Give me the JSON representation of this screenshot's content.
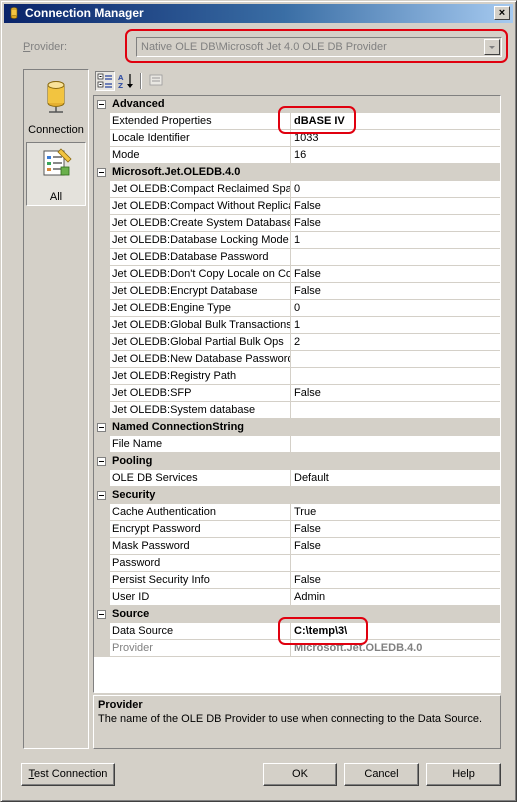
{
  "window": {
    "title": "Connection Manager",
    "close_glyph": "×"
  },
  "provider": {
    "label_prefix": "P",
    "label_rest": "rovider:",
    "value": "Native OLE DB\\Microsoft Jet 4.0 OLE DB Provider"
  },
  "sidebar": {
    "items": [
      {
        "label": "Connection",
        "icon": "database-cylinder-icon"
      },
      {
        "label": "All",
        "icon": "properties-sheet-icon",
        "selected": true
      }
    ]
  },
  "toolbar": {
    "buttons": [
      "categorized-icon",
      "alphabetical-icon",
      "property-pages-icon"
    ]
  },
  "grid": {
    "categories": [
      {
        "name": "Advanced",
        "props": [
          {
            "name": "Extended Properties",
            "value": "dBASE IV",
            "bold": true
          },
          {
            "name": "Locale Identifier",
            "value": "1033"
          },
          {
            "name": "Mode",
            "value": "16"
          }
        ]
      },
      {
        "name": "Microsoft.Jet.OLEDB.4.0",
        "props": [
          {
            "name": "Jet OLEDB:Compact Reclaimed Space",
            "value": "0"
          },
          {
            "name": "Jet OLEDB:Compact Without Replica",
            "value": "False"
          },
          {
            "name": "Jet OLEDB:Create System Database",
            "value": "False"
          },
          {
            "name": "Jet OLEDB:Database Locking Mode",
            "value": "1"
          },
          {
            "name": "Jet OLEDB:Database Password",
            "value": ""
          },
          {
            "name": "Jet OLEDB:Don't Copy Locale on Compact",
            "value": "False"
          },
          {
            "name": "Jet OLEDB:Encrypt Database",
            "value": "False"
          },
          {
            "name": "Jet OLEDB:Engine Type",
            "value": "0"
          },
          {
            "name": "Jet OLEDB:Global Bulk Transactions",
            "value": "1"
          },
          {
            "name": "Jet OLEDB:Global Partial Bulk Ops",
            "value": "2"
          },
          {
            "name": "Jet OLEDB:New Database Password",
            "value": ""
          },
          {
            "name": "Jet OLEDB:Registry Path",
            "value": ""
          },
          {
            "name": "Jet OLEDB:SFP",
            "value": "False"
          },
          {
            "name": "Jet OLEDB:System database",
            "value": ""
          }
        ]
      },
      {
        "name": "Named ConnectionString",
        "props": [
          {
            "name": "File Name",
            "value": ""
          }
        ]
      },
      {
        "name": "Pooling",
        "props": [
          {
            "name": "OLE DB Services",
            "value": "Default"
          }
        ]
      },
      {
        "name": "Security",
        "props": [
          {
            "name": "Cache Authentication",
            "value": "True"
          },
          {
            "name": "Encrypt Password",
            "value": "False"
          },
          {
            "name": "Mask Password",
            "value": "False"
          },
          {
            "name": "Password",
            "value": ""
          },
          {
            "name": "Persist Security Info",
            "value": "False"
          },
          {
            "name": "User ID",
            "value": "Admin"
          }
        ]
      },
      {
        "name": "Source",
        "props": [
          {
            "name": "Data Source",
            "value": "C:\\temp\\3\\",
            "bold": true
          },
          {
            "name": "Provider",
            "value": "Microsoft.Jet.OLEDB.4.0",
            "bold": true,
            "readonly": true
          }
        ]
      }
    ]
  },
  "description": {
    "title": "Provider",
    "text": "The name of the OLE DB Provider to use when connecting to the Data Source."
  },
  "buttons": {
    "test_prefix": "T",
    "test_rest": "est Connection",
    "ok": "OK",
    "cancel": "Cancel",
    "help": "Help"
  },
  "colors": {
    "highlight_ring": "#e0000f",
    "title_bar": "#0a246a"
  }
}
